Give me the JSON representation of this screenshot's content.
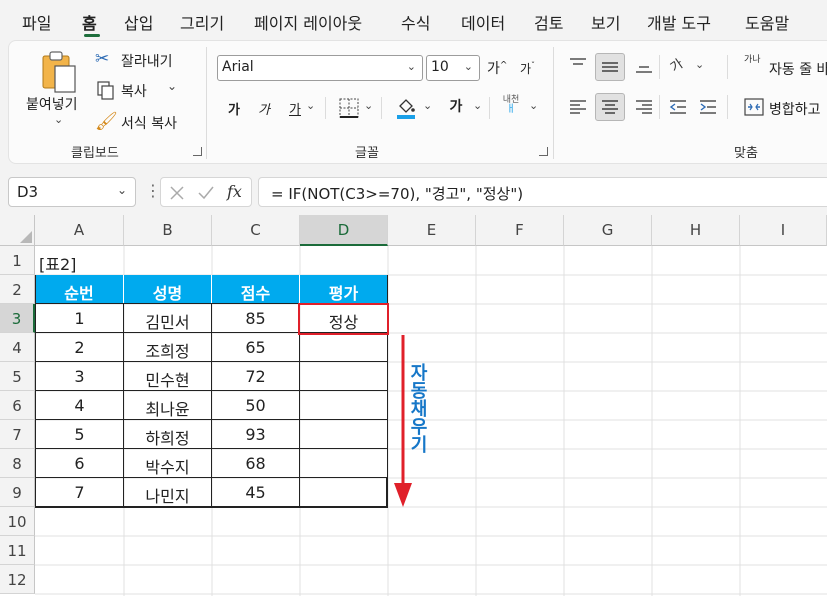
{
  "menu": {
    "tabs": [
      "파일",
      "홈",
      "삽입",
      "그리기",
      "페이지 레이아웃",
      "수식",
      "데이터",
      "검토",
      "보기",
      "개발 도구",
      "도움말"
    ],
    "active": "홈"
  },
  "ribbon": {
    "clipboard": {
      "paste_label": "붙여넣기",
      "cut_label": "잘라내기",
      "copy_label": "복사",
      "format_painter_label": "서식 복사",
      "group_label": "클립보드"
    },
    "font": {
      "font_name": "Arial",
      "font_size": "10",
      "bold": "가",
      "italic": "가",
      "underline": "가",
      "grow_font": "가",
      "shrink_font": "가",
      "font_color_label": "가",
      "phonetic_line1": "내천",
      "phonetic_line2": "ㅐ",
      "group_label": "글꼴"
    },
    "alignment": {
      "orientation_label": "가",
      "wrap_text_icon_label": "가나",
      "wrap_text_label": "자동 줄 바",
      "merge_label": "병합하고",
      "group_label": "맞춤"
    }
  },
  "formula_bar": {
    "name_box": "D3",
    "fx": "fx",
    "formula": "= IF(NOT(C3>=70), \"경고\", \"정상\")"
  },
  "sheet": {
    "columns": [
      "A",
      "B",
      "C",
      "D",
      "E",
      "F",
      "G",
      "H",
      "I"
    ],
    "selected_column": "D",
    "rows": [
      "1",
      "2",
      "3",
      "4",
      "5",
      "6",
      "7",
      "8",
      "9",
      "10",
      "11",
      "12"
    ],
    "selected_row": "3",
    "title": "[표2]",
    "headers": [
      "순번",
      "성명",
      "점수",
      "평가"
    ],
    "records": [
      [
        "1",
        "김민서",
        "85",
        "정상"
      ],
      [
        "2",
        "조희정",
        "65",
        ""
      ],
      [
        "3",
        "민수현",
        "72",
        ""
      ],
      [
        "4",
        "최나윤",
        "50",
        ""
      ],
      [
        "5",
        "하희정",
        "93",
        ""
      ],
      [
        "6",
        "박수지",
        "68",
        ""
      ],
      [
        "7",
        "나민지",
        "45",
        ""
      ]
    ]
  },
  "annotation": {
    "text": "자동채우기",
    "text_color": "#1677c8",
    "arrow_color": "#e0202a"
  },
  "colors": {
    "header_fill": "#00aaee",
    "selected_accent": "#1b6b3a"
  }
}
